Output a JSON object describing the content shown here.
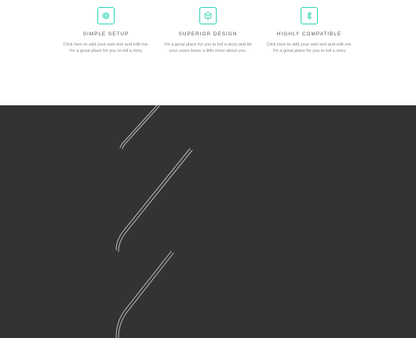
{
  "accent_color": "#2ed3b4",
  "features": [
    {
      "icon": "gear-icon",
      "title": "SIMPLE SETUP",
      "desc": "Click here to add your own text and edit me. I'm a great place for you to tell a story"
    },
    {
      "icon": "cube-icon",
      "title": "SUPERIOR DESIGN",
      "desc": "I'm a great place for you to tell a story and let your users know a little more about you."
    },
    {
      "icon": "bluetooth-icon",
      "title": "HIGHLY COMPATIBLE",
      "desc": "Click here to add your own text and edit me. I'm a great place for you to tell a story"
    }
  ],
  "dark_section_color": "#333333"
}
